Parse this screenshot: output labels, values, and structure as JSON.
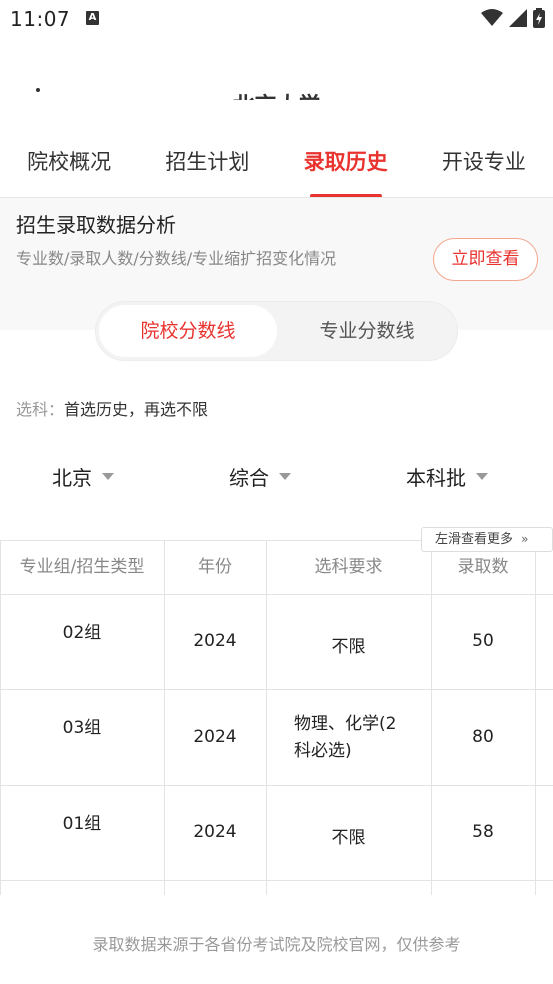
{
  "status_bar": {
    "time": "11:07",
    "notification_letter": "A"
  },
  "header": {
    "title": "北京大学"
  },
  "tabs": [
    {
      "label": "院校概况"
    },
    {
      "label": "招生计划"
    },
    {
      "label": "录取历史",
      "active": true
    },
    {
      "label": "开设专业"
    }
  ],
  "banner": {
    "title": "招生录取数据分析",
    "subtitle": "专业数/录取人数/分数线/专业缩扩招变化情况",
    "button": "立即查看"
  },
  "segment": {
    "active": "院校分数线",
    "inactive": "专业分数线"
  },
  "subject": {
    "label": "选科：",
    "value": "首选历史，再选不限"
  },
  "filters": {
    "province": "北京",
    "type": "综合",
    "batch": "本科批"
  },
  "swipe_hint": "左滑查看更多",
  "table": {
    "headers": [
      "专业组/招生类型",
      "年份",
      "选科要求",
      "录取数"
    ],
    "rows": [
      {
        "group": "02组",
        "year": "2024",
        "requirement_line1": "不限",
        "requirement_line2": "",
        "count": "50"
      },
      {
        "group": "03组",
        "year": "2024",
        "requirement_line1": "物理、化学(2",
        "requirement_line2": "科必选)",
        "count": "80"
      },
      {
        "group": "01组",
        "year": "2024",
        "requirement_line1": "不限",
        "requirement_line2": "",
        "count": "58"
      }
    ]
  },
  "footer": {
    "text": "录取数据来源于各省份考试院及院校官网，仅供参考"
  },
  "colors": {
    "accent": "#e8332f",
    "muted": "#999999",
    "banner_bg": "#f8f8f8"
  }
}
